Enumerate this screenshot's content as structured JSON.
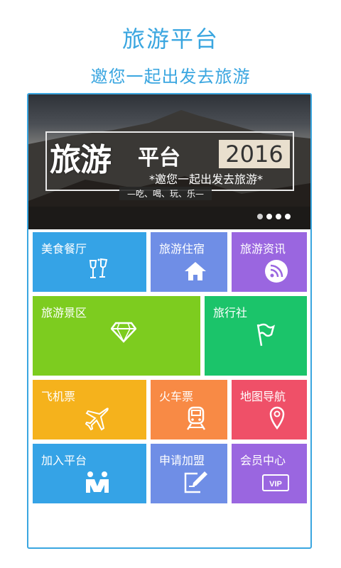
{
  "header": {
    "title": "旅游平台",
    "subtitle": "邀您一起出发去旅游"
  },
  "banner": {
    "headline": "旅游",
    "headline_small": "平台",
    "year": "2016",
    "slogan": "*邀您一起出发去旅游*",
    "tagline": "—吃、喝、玩、乐—",
    "carousel_active_index": 0,
    "carousel_count": 4
  },
  "tiles": [
    {
      "label": "美食餐厅",
      "icon": "wine-glasses-icon",
      "color": "#35a3e6"
    },
    {
      "label": "旅游住宿",
      "icon": "home-icon",
      "color": "#6f8ee6"
    },
    {
      "label": "旅游资讯",
      "icon": "rss-icon",
      "color": "#9a66e0"
    },
    {
      "label": "旅游景区",
      "icon": "diamond-icon",
      "color": "#7dcc1f"
    },
    {
      "label": "旅行社",
      "icon": "flag-icon",
      "color": "#1bc46a"
    },
    {
      "label": "飞机票",
      "icon": "airplane-icon",
      "color": "#f5b21c"
    },
    {
      "label": "火车票",
      "icon": "train-icon",
      "color": "#f88a45"
    },
    {
      "label": "地图导航",
      "icon": "map-pin-icon",
      "color": "#ef5068"
    },
    {
      "label": "加入平台",
      "icon": "join-people-icon",
      "color": "#35a3e6"
    },
    {
      "label": "申请加盟",
      "icon": "edit-form-icon",
      "color": "#6f8ee6"
    },
    {
      "label": "会员中心",
      "icon": "vip-card-icon",
      "color": "#9a66e0"
    }
  ]
}
